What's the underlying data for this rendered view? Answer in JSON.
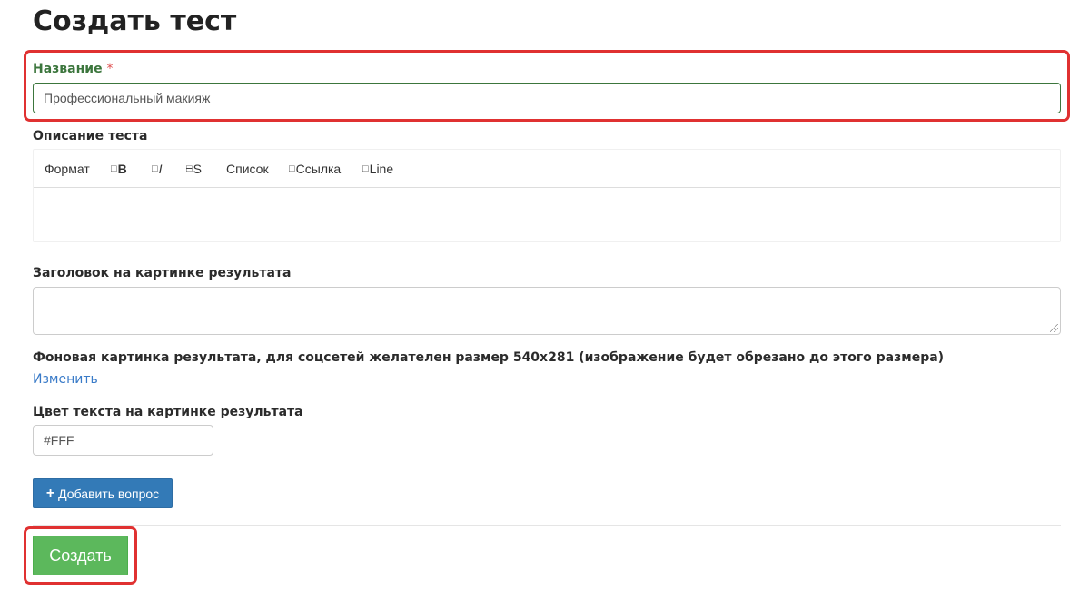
{
  "page": {
    "title": "Создать тест"
  },
  "name_field": {
    "label": "Название",
    "required_mark": "*",
    "value": "Профессиональный макияж"
  },
  "description": {
    "label": "Описание теста",
    "toolbar": {
      "format": "Формат",
      "bold": "B",
      "italic": "I",
      "strike": "S",
      "list": "Список",
      "link": "Ссылка",
      "line": "Line"
    }
  },
  "result_heading": {
    "label": "Заголовок на картинке результата",
    "value": ""
  },
  "result_background": {
    "label": "Фоновая картинка результата, для соцсетей желателен размер 540х281 (изображение будет обрезано до этого размера)",
    "change_link": "Изменить"
  },
  "text_color": {
    "label": "Цвет текста на картинке результата",
    "value": "#FFF"
  },
  "buttons": {
    "add_question": "Добавить вопрос",
    "create": "Создать"
  },
  "colors": {
    "primary": "#337ab7",
    "success": "#5cb85c",
    "highlight": "#e03131",
    "success_label": "#3c763d"
  }
}
